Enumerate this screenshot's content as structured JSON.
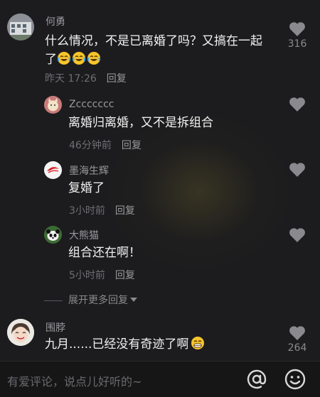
{
  "comments": [
    {
      "name": "何勇",
      "text": "什么情况，不是已离婚了吗？又搞在一起了",
      "emojis": [
        "laugh-cry",
        "laugh-cry",
        "laugh-cry"
      ],
      "time": "昨天 17:26",
      "reply": "回复",
      "likes": "316",
      "avatar_icon": "building-photo-avatar"
    },
    {
      "name": "Zccccccc",
      "text": "离婚归离婚，又不是拆组合",
      "time": "46分钟前",
      "reply": "回复",
      "avatar_icon": "cat-avatar"
    },
    {
      "name": "墨海生辉",
      "text": "复婚了",
      "time": "3小时前",
      "reply": "回复",
      "avatar_icon": "red-logo-avatar"
    },
    {
      "name": "大熊猫",
      "text": "组合还在啊！",
      "time": "5小时前",
      "reply": "回复",
      "avatar_icon": "panda-avatar"
    },
    {
      "name": "围脖",
      "text": "九月......已经没有奇迹了啊",
      "emojis": [
        "grin"
      ],
      "likes": "264",
      "avatar_icon": "person-photo-avatar"
    }
  ],
  "expand_more": "展开更多回复",
  "input": {
    "placeholder": "有爱评论，说点儿好听的~"
  },
  "icons": {
    "like": "heart-icon",
    "mention": "at-icon",
    "emoji_picker": "smile-icon"
  },
  "colors": {
    "background": "#1c1c1e",
    "text": "#f2f2f2",
    "muted": "#6f6f74"
  }
}
